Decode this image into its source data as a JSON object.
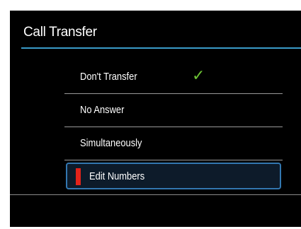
{
  "header": {
    "title": "Call Transfer"
  },
  "menu": {
    "items": [
      {
        "label": "Don't Transfer",
        "checked": true
      },
      {
        "label": "No Answer",
        "checked": false
      },
      {
        "label": "Simultaneously",
        "checked": false
      },
      {
        "label": "Edit Numbers",
        "checked": false,
        "selected": true
      }
    ],
    "check_glyph": "✓"
  },
  "colors": {
    "background": "#000000",
    "accent": "#3a9bc8",
    "selection_border": "#3277b0",
    "selection_marker": "#e2231a",
    "check": "#6cc234",
    "text": "#ffffff"
  },
  "icons": {
    "check": "check-icon"
  }
}
